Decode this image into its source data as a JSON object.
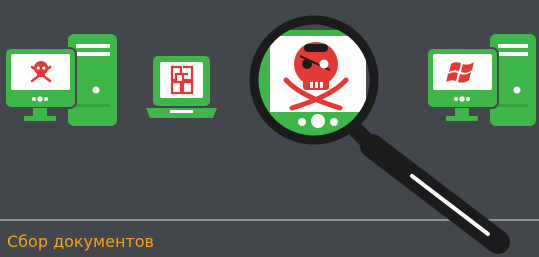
{
  "caption": "Сбор документов",
  "colors": {
    "background": "#43474c",
    "device_green": "#3fb64a",
    "device_green_dark": "#34a03f",
    "screen_white": "#ffffff",
    "pirate_red": "#e53935",
    "divider": "#8c9196",
    "caption_orange": "#f5a11c",
    "magnifier_black": "#1b1b1b",
    "windows_red": "#e53935"
  },
  "icons": [
    "infected-desktop-icon",
    "office-laptop-icon",
    "magnifier-icon",
    "skull-crossbones-icon",
    "windows-desktop-icon"
  ]
}
